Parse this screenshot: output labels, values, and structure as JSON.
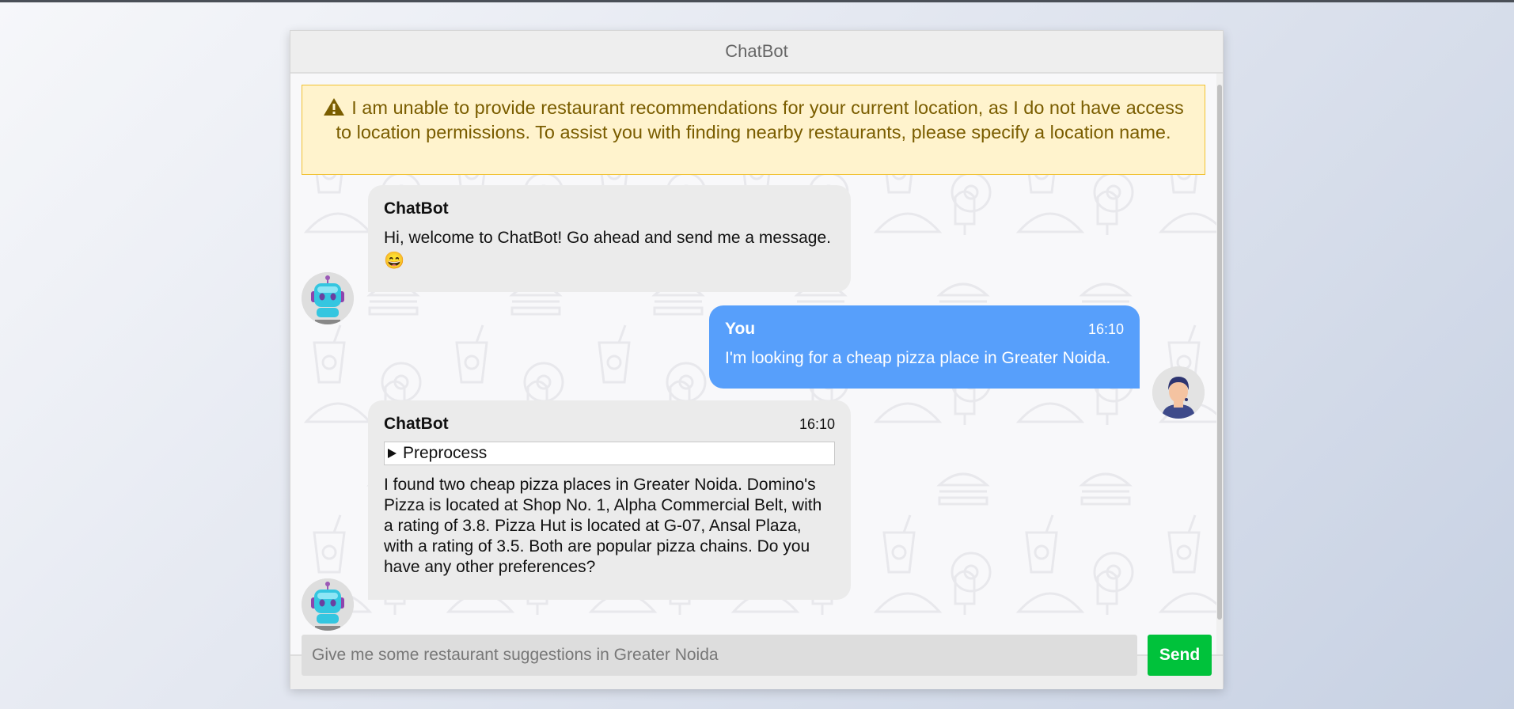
{
  "app": {
    "title": "ChatBot"
  },
  "alert": {
    "icon": "warning-icon",
    "text": "I am unable to provide restaurant recommendations for your current location, as I do not have access to location permissions. To assist you with finding nearby restaurants, please specify a location name."
  },
  "messages": [
    {
      "sender": "ChatBot",
      "time": "",
      "text": "Hi, welcome to ChatBot! Go ahead and send me a message. 😄",
      "avatar": "robot-avatar"
    },
    {
      "sender": "You",
      "time": "16:10",
      "text": "I'm looking for a cheap pizza place in Greater Noida.",
      "avatar": "user-avatar"
    },
    {
      "sender": "ChatBot",
      "time": "16:10",
      "details_label": "Preprocess",
      "text": "I found two cheap pizza places in Greater Noida. Domino's Pizza is located at Shop No. 1, Alpha Commercial Belt, with a rating of 3.8. Pizza Hut is located at G-07, Ansal Plaza, with a rating of 3.5. Both are popular pizza chains. Do you have any other preferences?",
      "avatar": "robot-avatar"
    }
  ],
  "composer": {
    "placeholder": "Give me some restaurant suggestions in Greater Noida",
    "send_label": "Send"
  },
  "colors": {
    "user_bubble": "#579ffb",
    "bot_bubble": "#ebebeb",
    "send_button": "#00c23b",
    "alert_bg": "#fff3cd"
  }
}
